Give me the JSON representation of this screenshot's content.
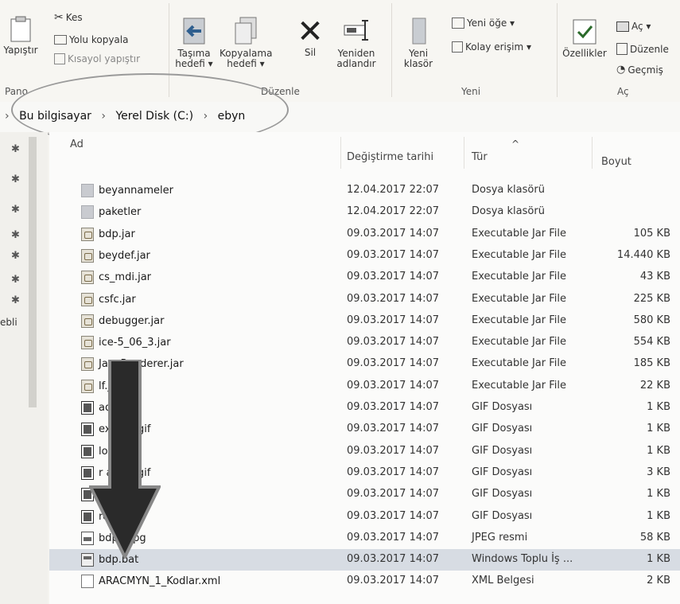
{
  "ribbon": {
    "paste_label": "Yapıştır",
    "cut_label": "Kes",
    "copy_path_label": "Yolu kopyala",
    "paste_shortcut_label": "Kısayol yapıştır",
    "move_to_label": "Taşıma hedefi ▾",
    "copy_to_label": "Kopyalama hedefi ▾",
    "delete_label": "Sil",
    "rename_label": "Yeniden adlandır",
    "new_folder_label": "Yeni klasör",
    "new_item_label": "Yeni öğe ▾",
    "easy_access_label": "Kolay erişim ▾",
    "properties_label": "Özellikler",
    "open_label": "Aç ▾",
    "edit_label": "Düzenle",
    "history_label": "Geçmiş",
    "group_clipboard": "Pano",
    "group_organize": "Düzenle",
    "group_new": "Yeni",
    "group_open": "Aç"
  },
  "address": {
    "crumbs": [
      "Bu bilgisayar",
      "Yerel Disk (C:)",
      "ebyn"
    ]
  },
  "nav": {
    "truncated_label": "ebli"
  },
  "columns": {
    "name": "Ad",
    "date": "Değiştirme tarihi",
    "type": "Tür",
    "size": "Boyut"
  },
  "files": [
    {
      "name": "beyannameler",
      "date": "12.04.2017 22:07",
      "type": "Dosya klasörü",
      "size": "",
      "icon": "folder-icon"
    },
    {
      "name": "paketler",
      "date": "12.04.2017 22:07",
      "type": "Dosya klasörü",
      "size": "",
      "icon": "folder-icon"
    },
    {
      "name": "bdp.jar",
      "date": "09.03.2017 14:07",
      "type": "Executable Jar File",
      "size": "105 KB",
      "icon": "jar-file-icon"
    },
    {
      "name": "beydef.jar",
      "date": "09.03.2017 14:07",
      "type": "Executable Jar File",
      "size": "14.440 KB",
      "icon": "jar-file-icon"
    },
    {
      "name": "cs_mdi.jar",
      "date": "09.03.2017 14:07",
      "type": "Executable Jar File",
      "size": "43 KB",
      "icon": "jar-file-icon"
    },
    {
      "name": "csfc.jar",
      "date": "09.03.2017 14:07",
      "type": "Executable Jar File",
      "size": "225 KB",
      "icon": "jar-file-icon"
    },
    {
      "name": "debugger.jar",
      "date": "09.03.2017 14:07",
      "type": "Executable Jar File",
      "size": "580 KB",
      "icon": "jar-file-icon"
    },
    {
      "name": "ice-5_06_3.jar",
      "date": "09.03.2017 14:07",
      "type": "Executable Jar File",
      "size": "554 KB",
      "icon": "jar-file-icon"
    },
    {
      "name": "JavaRenderer.jar",
      "date": "09.03.2017 14:07",
      "type": "Executable Jar File",
      "size": "185 KB",
      "icon": "jar-file-icon"
    },
    {
      "name": "lf.ja",
      "date": "09.03.2017 14:07",
      "type": "Executable Jar File",
      "size": "22 KB",
      "icon": "jar-file-icon"
    },
    {
      "name": "adc",
      "date": "09.03.2017 14:07",
      "type": "GIF Dosyası",
      "size": "1 KB",
      "icon": "gif-file-icon"
    },
    {
      "name": "exc      ort.gif",
      "date": "09.03.2017 14:07",
      "type": "GIF Dosyası",
      "size": "1 KB",
      "icon": "gif-file-icon"
    },
    {
      "name": "loo      n.gif",
      "date": "09.03.2017 14:07",
      "type": "GIF Dosyası",
      "size": "1 KB",
      "icon": "gif-file-icon"
    },
    {
      "name": "r        anligi.gif",
      "date": "09.03.2017 14:07",
      "type": "GIF Dosyası",
      "size": "3 KB",
      "icon": "gif-file-icon"
    },
    {
      "name": "qu       if",
      "date": "09.03.2017 14:07",
      "type": "GIF Dosyası",
      "size": "1 KB",
      "icon": "gif-file-icon"
    },
    {
      "name": "rem      gif",
      "date": "09.03.2017 14:07",
      "type": "GIF Dosyası",
      "size": "1 KB",
      "icon": "gif-file-icon"
    },
    {
      "name": "bdp_   .jpg",
      "date": "09.03.2017 14:07",
      "type": "JPEG resmi",
      "size": "58 KB",
      "icon": "jpg-file-icon"
    },
    {
      "name": "bdp.bat",
      "date": "09.03.2017 14:07",
      "type": "Windows Toplu İş ...",
      "size": "1 KB",
      "icon": "bat-file-icon",
      "selected": true
    },
    {
      "name": "ARACMYN_1_Kodlar.xml",
      "date": "09.03.2017 14:07",
      "type": "XML Belgesi",
      "size": "2 KB",
      "icon": "xml-file-icon"
    }
  ]
}
